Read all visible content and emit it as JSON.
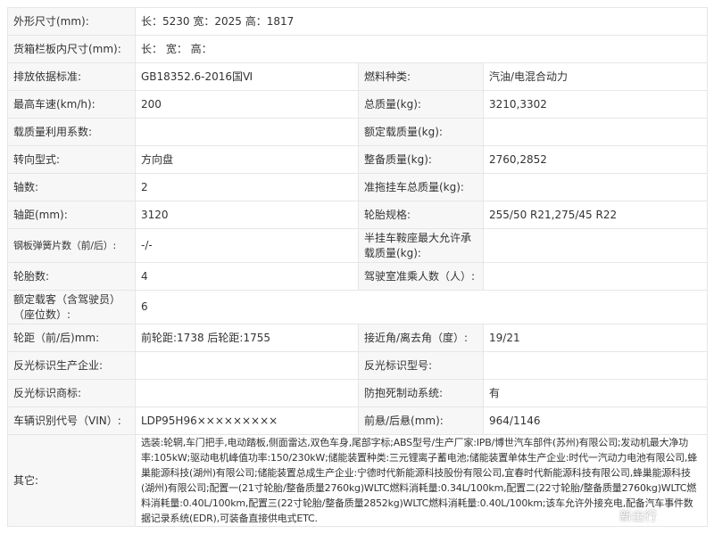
{
  "rows": [
    {
      "label": "外形尺寸(mm):",
      "value": "长：5230 宽：2025 高：1817"
    },
    {
      "label": "货箱栏板内尺寸(mm):",
      "value": "长：  宽：  高："
    },
    {
      "label": "排放依据标准:",
      "value": "GB18352.6-2016国Ⅵ",
      "label2": "燃料种类:",
      "value2": "汽油/电混合动力"
    },
    {
      "label": "最高车速(km/h):",
      "value": "200",
      "label2": "总质量(kg):",
      "value2": "3210,3302"
    },
    {
      "label": "载质量利用系数:",
      "value": "",
      "label2": "额定载质量(kg):",
      "value2": ""
    },
    {
      "label": "转向型式:",
      "value": "方向盘",
      "label2": "整备质量(kg):",
      "value2": "2760,2852"
    },
    {
      "label": "轴数:",
      "value": "2",
      "label2": "准拖挂车总质量(kg):",
      "value2": ""
    },
    {
      "label": "轴距(mm):",
      "value": "3120",
      "label2": "轮胎规格:",
      "value2": "255/50 R21,275/45 R22"
    },
    {
      "label": "钢板弹簧片数（前/后）:",
      "value": "-/-",
      "label2": "半挂车鞍座最大允许承载质量(kg):",
      "value2": ""
    },
    {
      "label": "轮胎数:",
      "value": "4",
      "label2": "驾驶室准乘人数（人）:",
      "value2": ""
    },
    {
      "label": "额定载客（含驾驶员）（座位数）:",
      "value": "6"
    },
    {
      "label": "轮距（前/后)mm:",
      "value": "前轮距:1738 后轮距:1755",
      "label2": "接近角/离去角（度）:",
      "value2": "19/21"
    },
    {
      "label": "反光标识生产企业:",
      "value": "",
      "label2": "反光标识型号:",
      "value2": ""
    },
    {
      "label": "反光标识商标:",
      "value": "",
      "label2": "防抱死制动系统:",
      "value2": "有"
    },
    {
      "label": "车辆识别代号（VIN）:",
      "value": "LDP95H96×××××××××",
      "label2": "前悬/后悬(mm):",
      "value2": "964/1146"
    },
    {
      "label": "其它:",
      "value": "选装:轮辋,车门把手,电动踏板,侧面雷达,双色车身,尾部字标;ABS型号/生产厂家:IPB/博世汽车部件(苏州)有限公司;发动机最大净功率:105kW;驱动电机峰值功率:150/230kW;储能装置种类:三元锂离子蓄电池;储能装置单体生产企业:时代一汽动力电池有限公司,蜂巢能源科技(湖州)有限公司;储能装置总成生产企业:宁德时代新能源科技股份有限公司,宜春时代新能源科技有限公司,蜂巢能源科技(湖州)有限公司;配置一(21寸轮胎/整备质量2760kg)WLTC燃料消耗量:0.34L/100km,配置二(22寸轮胎/整备质量2760kg)WLTC燃料消耗量:0.40L/100km,配置三(22寸轮胎/整备质量2852kg)WLTC燃料消耗量:0.40L/100km;该车允许外接充电,配备汽车事件数据记录系统(EDR),可装备直接供电式ETC."
    }
  ],
  "watermark": "新出行"
}
